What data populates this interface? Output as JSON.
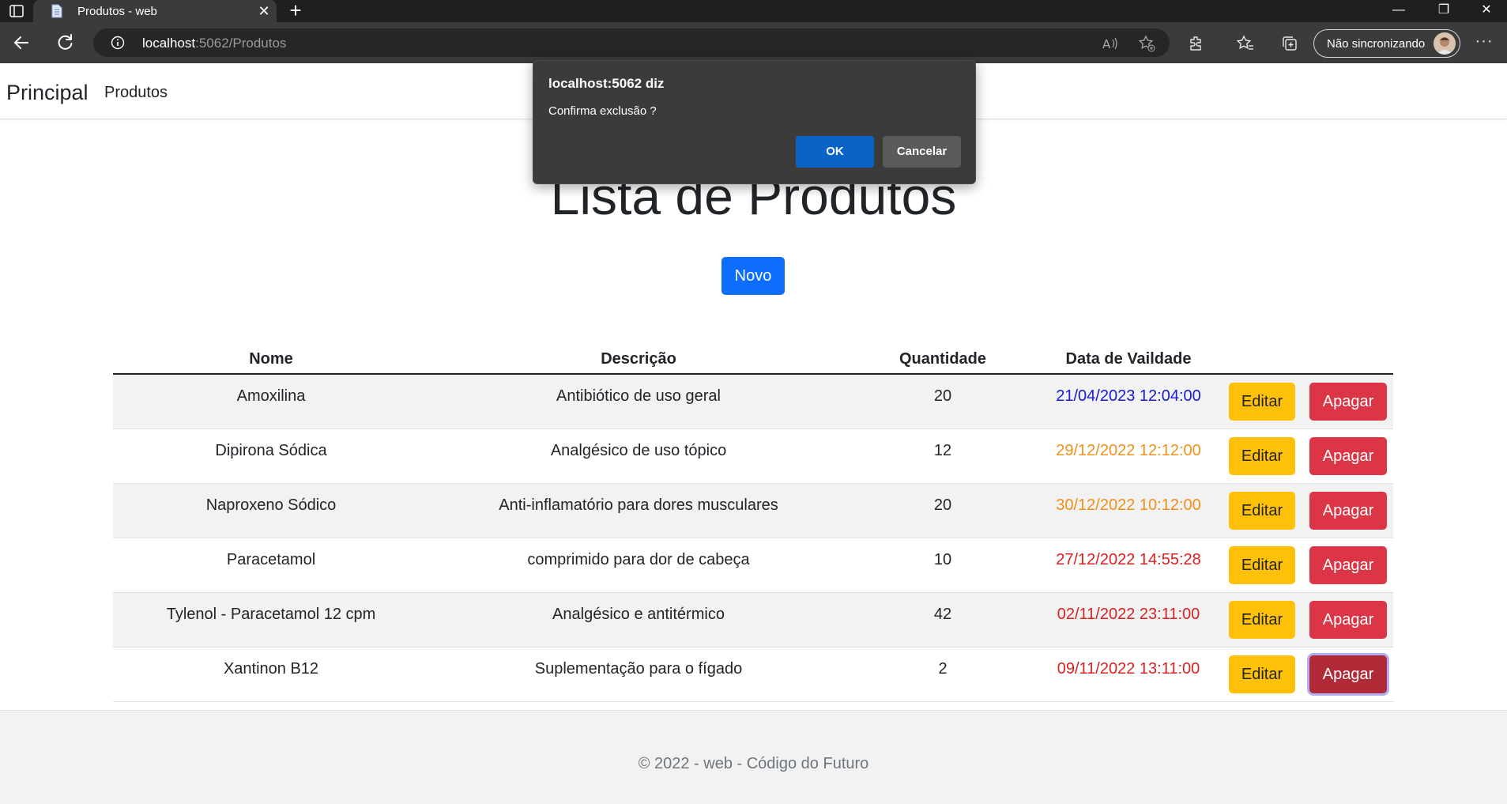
{
  "browser": {
    "tab_title": "Produtos - web",
    "url_host": "localhost",
    "url_path": ":5062/Produtos",
    "sync_label": "Não sincronizando"
  },
  "navbar": {
    "brand": "Principal",
    "links": [
      "Produtos"
    ]
  },
  "main": {
    "title": "Lista de Produtos",
    "new_button": "Novo"
  },
  "table": {
    "headers": [
      "Nome",
      "Descrição",
      "Quantidade",
      "Data de Vaildade"
    ],
    "edit_label": "Editar",
    "delete_label": "Apagar",
    "rows": [
      {
        "nome": "Amoxilina",
        "descricao": "Antibiótico de uso geral",
        "quantidade": "20",
        "data": "21/04/2023 12:04:00",
        "data_color": "#1a1ad4"
      },
      {
        "nome": "Dipirona Sódica",
        "descricao": "Analgésico de uso tópico",
        "quantidade": "12",
        "data": "29/12/2022 12:12:00",
        "data_color": "#f0901a"
      },
      {
        "nome": "Naproxeno Sódico",
        "descricao": "Anti-inflamatório para dores musculares",
        "quantidade": "20",
        "data": "30/12/2022 10:12:00",
        "data_color": "#f0901a"
      },
      {
        "nome": "Paracetamol",
        "descricao": "comprimido para dor de cabeça",
        "quantidade": "10",
        "data": "27/12/2022 14:55:28",
        "data_color": "#dc2020"
      },
      {
        "nome": "Tylenol - Paracetamol 12 cpm",
        "descricao": "Analgésico e antitérmico",
        "quantidade": "42",
        "data": "02/11/2022 23:11:00",
        "data_color": "#dc2020"
      },
      {
        "nome": "Xantinon B12",
        "descricao": "Suplementação para o fígado",
        "quantidade": "2",
        "data": "09/11/2022 13:11:00",
        "data_color": "#dc2020"
      }
    ]
  },
  "footer": {
    "text": "© 2022 - web - Código do Futuro"
  },
  "dialog": {
    "title": "localhost:5062 diz",
    "message": "Confirma exclusão ?",
    "ok_label": "OK",
    "cancel_label": "Cancelar"
  },
  "colors": {
    "primary": "#0d6efd",
    "warning": "#ffc107",
    "danger": "#dc3545"
  }
}
